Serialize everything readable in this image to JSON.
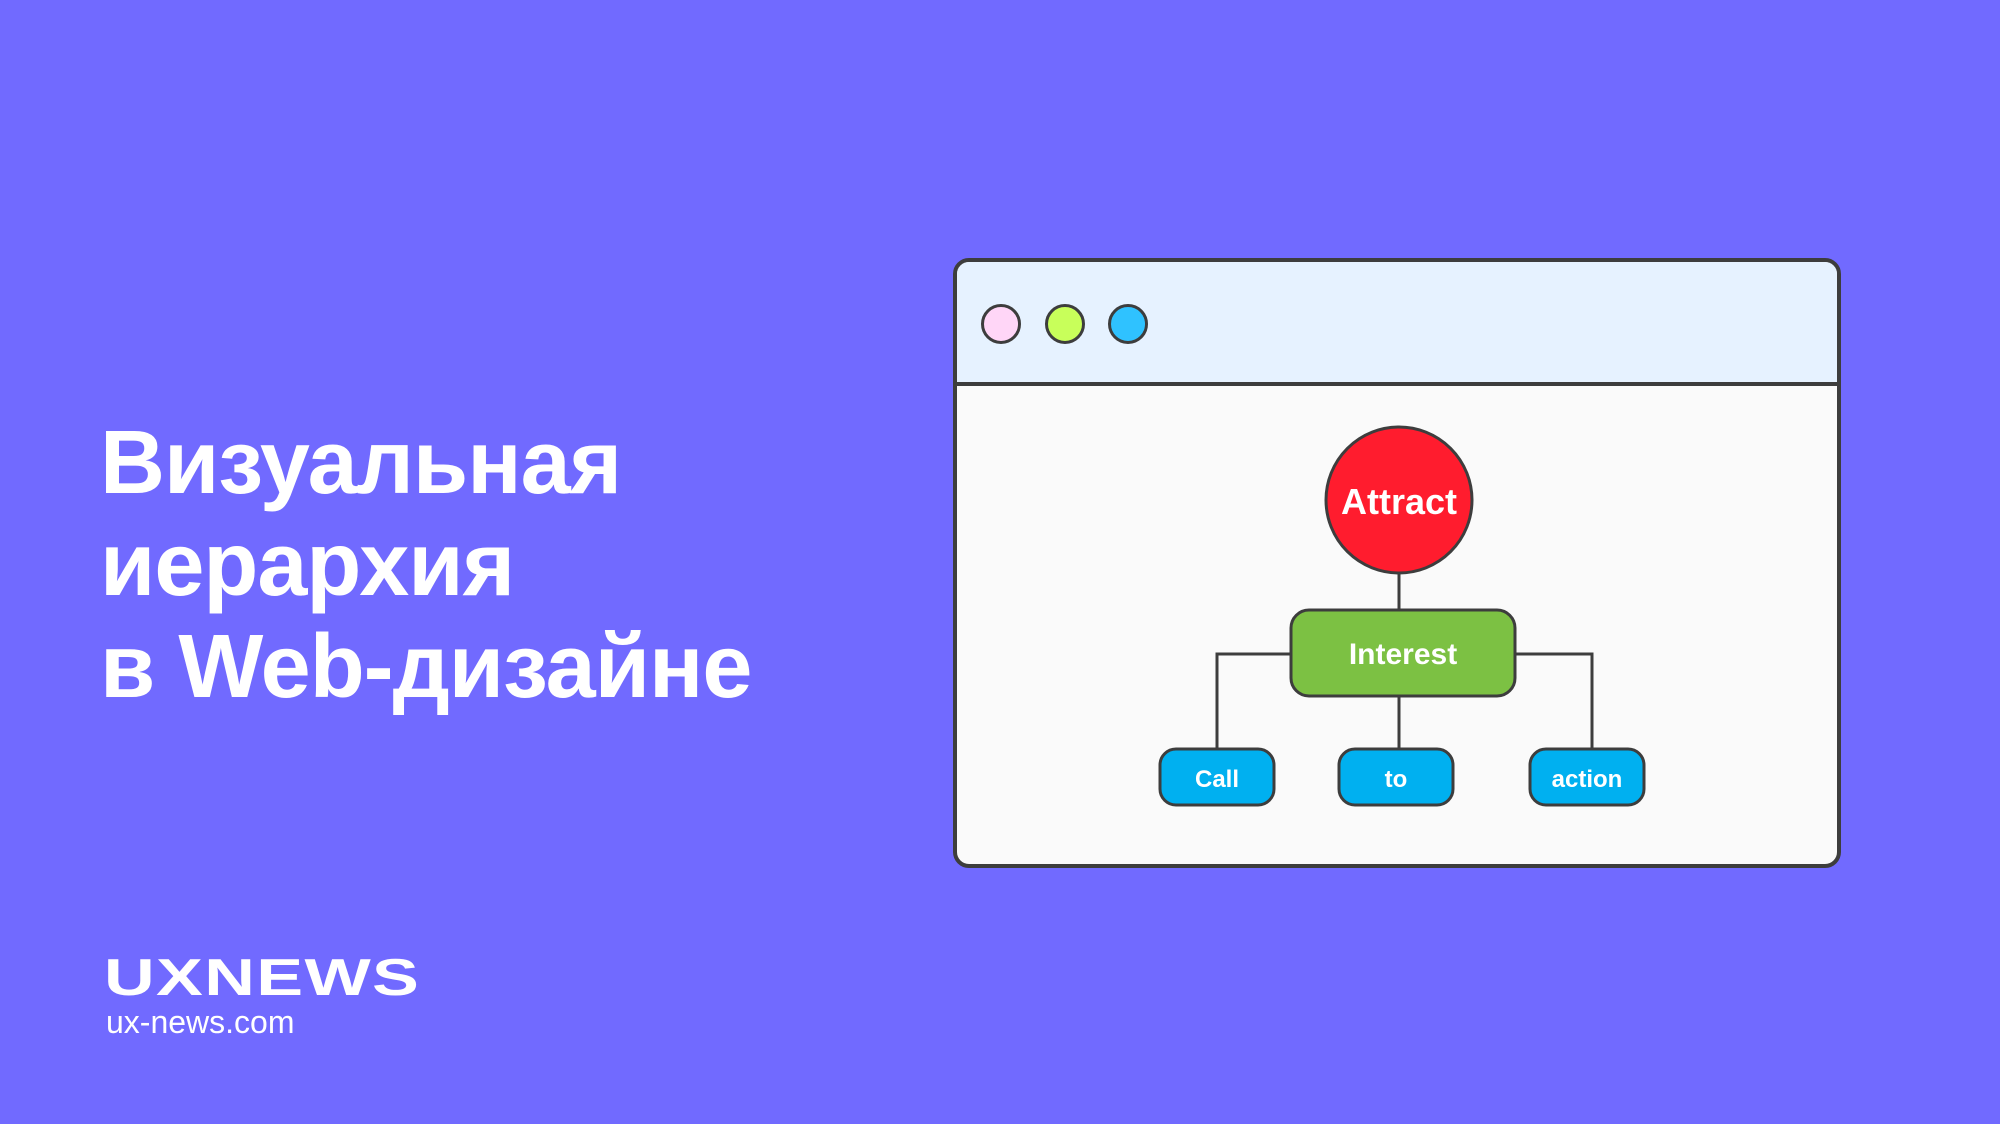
{
  "title": {
    "lines": [
      "Визуальная",
      "иерархия",
      "в Web-дизайне"
    ]
  },
  "brand": {
    "logo": "UXNEWS",
    "url": "ux-news.com"
  },
  "window": {
    "dots": [
      {
        "name": "pink-dot",
        "color": "#ffd6f7"
      },
      {
        "name": "green-dot",
        "color": "#c8ff5a"
      },
      {
        "name": "blue-dot",
        "color": "#2fc2ff"
      }
    ],
    "diagram": {
      "top": {
        "label": "Attract",
        "color": "#ff1c2e"
      },
      "middle": {
        "label": "Interest",
        "color": "#7cc143"
      },
      "children": [
        {
          "label": "Call"
        },
        {
          "label": "to"
        },
        {
          "label": "action"
        }
      ],
      "child_color": "#00b0f0"
    }
  }
}
